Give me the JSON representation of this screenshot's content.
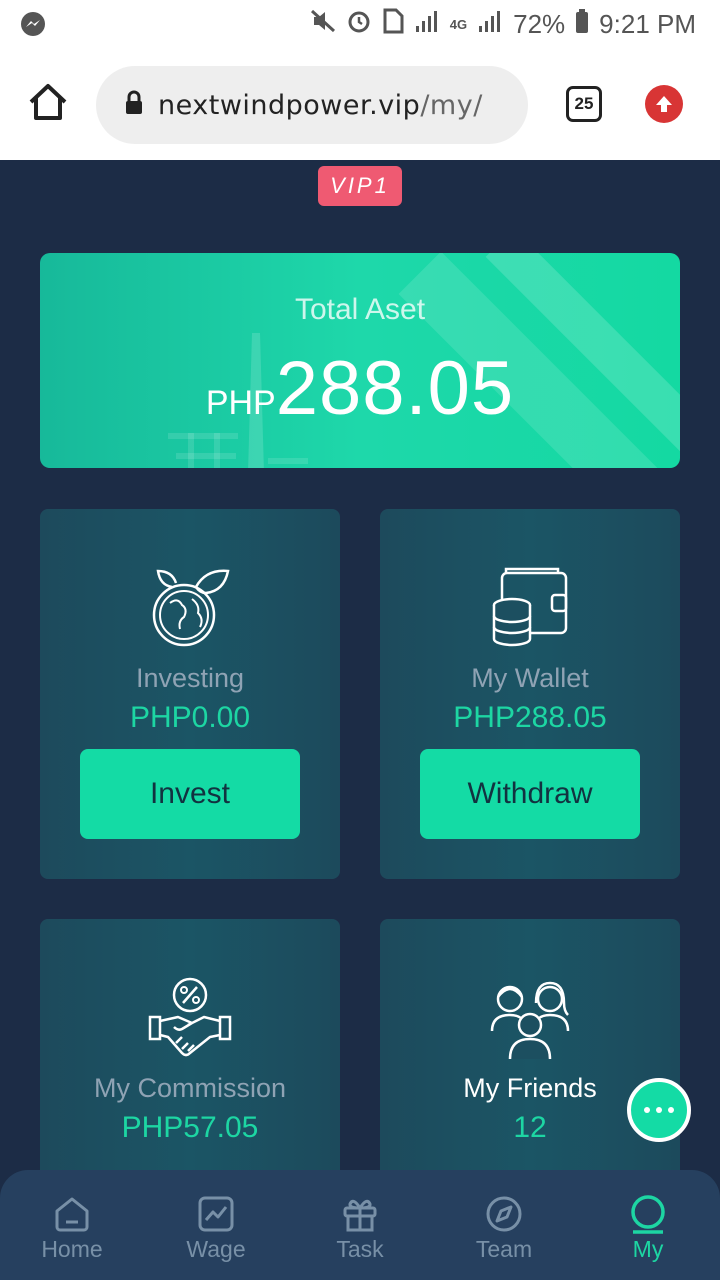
{
  "status_bar": {
    "battery": "72%",
    "time": "9:21 PM",
    "network": "4G"
  },
  "browser": {
    "url_domain": "nextwindpower.vip",
    "url_path": "/my/",
    "tab_count": "25"
  },
  "vip": {
    "label": "VIP1"
  },
  "total": {
    "label": "Total Aset",
    "currency": "PHP",
    "amount": "288.05"
  },
  "tiles": {
    "investing": {
      "title": "Investing",
      "value": "PHP0.00",
      "action": "Invest"
    },
    "wallet": {
      "title": "My Wallet",
      "value": "PHP288.05",
      "action": "Withdraw"
    },
    "commission": {
      "title": "My Commission",
      "value": "PHP57.05"
    },
    "friends": {
      "title": "My Friends",
      "value": "12"
    }
  },
  "nav": {
    "items": [
      {
        "label": "Home",
        "icon": "home-icon"
      },
      {
        "label": "Wage",
        "icon": "chart-icon"
      },
      {
        "label": "Task",
        "icon": "gift-icon"
      },
      {
        "label": "Team",
        "icon": "compass-icon"
      },
      {
        "label": "My",
        "icon": "user-icon"
      }
    ],
    "active": "My"
  },
  "colors": {
    "accent": "#1dd6a3",
    "background": "#1c2c46",
    "vip": "#ef5a72"
  }
}
